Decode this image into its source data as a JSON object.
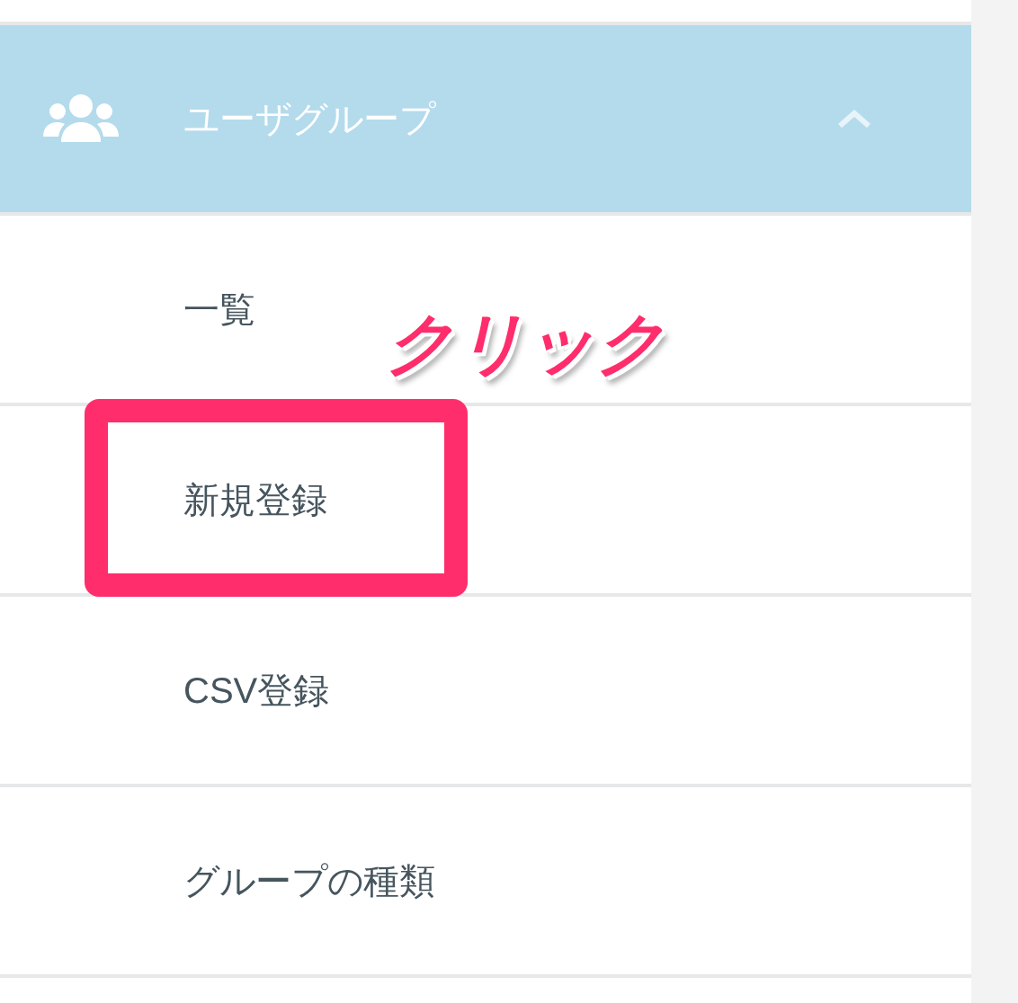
{
  "menu_group": {
    "label": "ユーザグループ",
    "expanded": true,
    "items": [
      {
        "label": "一覧",
        "highlighted": false
      },
      {
        "label": "新規登録",
        "highlighted": true
      },
      {
        "label": "CSV登録",
        "highlighted": false
      },
      {
        "label": "グループの種類",
        "highlighted": false
      }
    ]
  },
  "annotation": {
    "text": "クリック"
  }
}
